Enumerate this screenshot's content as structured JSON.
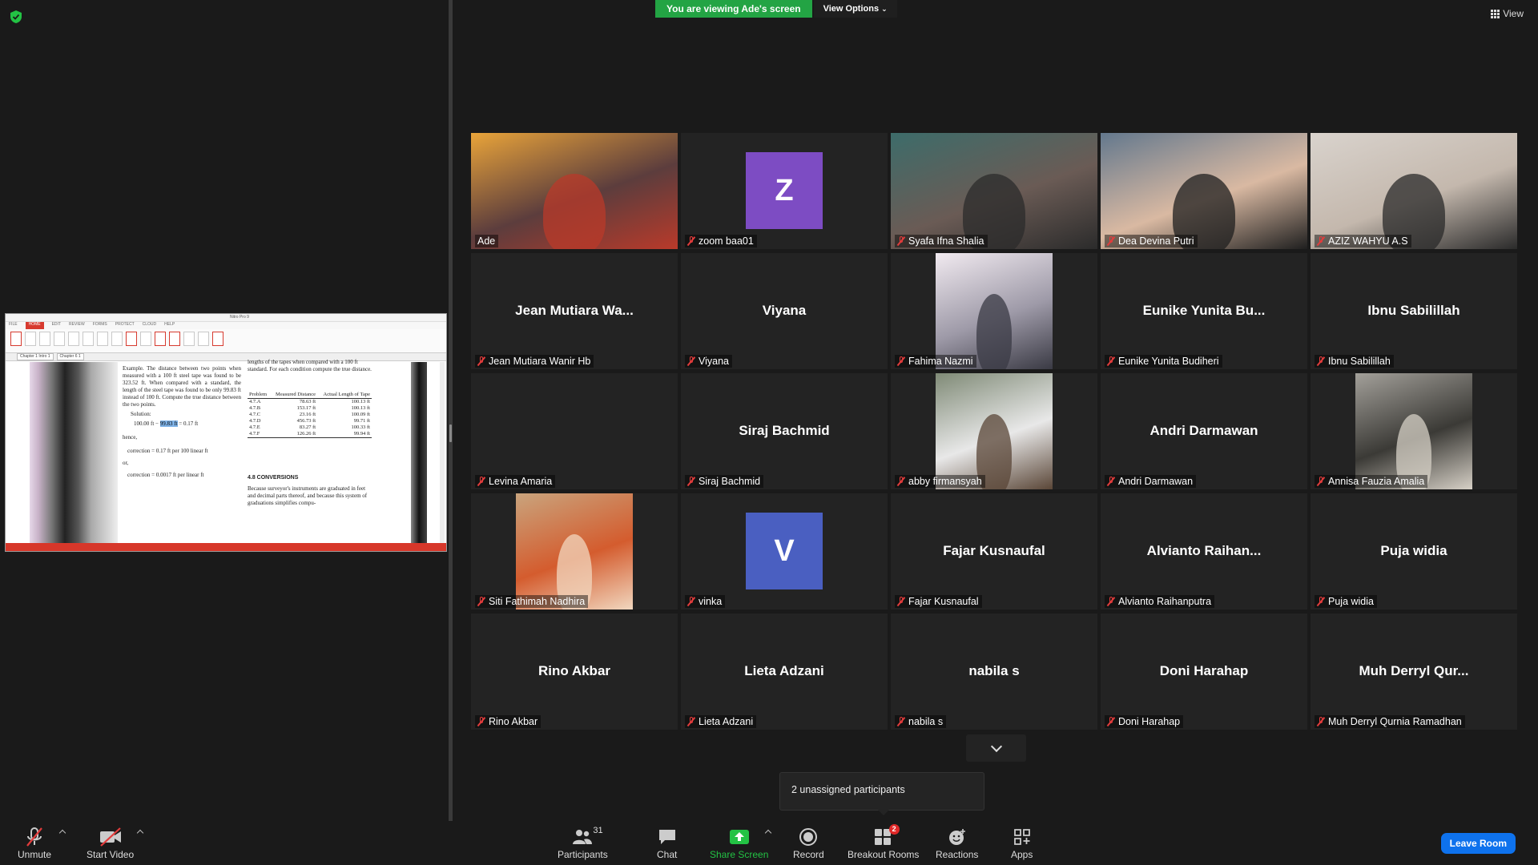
{
  "banner": {
    "viewing": "You are viewing Ade's screen",
    "view_options": "View Options"
  },
  "view_button": "View",
  "shared_window": {
    "title": "Nitro Pro 9",
    "ribbon_tabs": [
      "FILE",
      "HOME",
      "EDIT",
      "REVIEW",
      "FORMS",
      "PROTECT",
      "CLOUD",
      "HELP"
    ],
    "doc_tabs": [
      "Chapter 1 Intro 1",
      "Chapter 6 1"
    ],
    "left_col": {
      "example": "Example. The distance between two points when measured with a 100 ft steel tape was found to be 323.52 ft. When compared with a standard, the length of the steel tape was found to be only 99.83 ft instead of 100 ft. Compute the true distance between the two points.",
      "solution": "Solution:",
      "eq_pre": "100.00 ft −",
      "eq_hl": "99.83 ft",
      "eq_post": "= 0.17 ft",
      "hence": "hence,",
      "corr1": "correction = 0.17 ft per 100 linear ft",
      "or": "or,",
      "corr2": "correction = 0.0017 ft per linear ft"
    },
    "right_col": {
      "intro": "lengths of the tapes when compared with a 100 ft standard. For each condition compute the true distance.",
      "headers": [
        "Problem",
        "Measured Distance",
        "Actual Length of Tape"
      ],
      "rows": [
        [
          "4.7.A",
          "78.63 ft",
          "100.13 ft"
        ],
        [
          "4.7.B",
          "153.17 ft",
          "100.13 ft"
        ],
        [
          "4.7.C",
          "23.16 ft",
          "100.09 ft"
        ],
        [
          "4.7.D",
          "456.73 ft",
          "99.71 ft"
        ],
        [
          "4.7.E",
          "83.27 ft",
          "100.33 ft"
        ],
        [
          "4.7.F",
          "126.26 ft",
          "99.94 ft"
        ]
      ],
      "section": "4.8   CONVERSIONS",
      "section_text": "Because surveyor's instruments are graduated in feet and decimal parts thereof, and because this system of graduations simplifies compu-"
    }
  },
  "tiles": [
    {
      "label": "Ade",
      "center": "",
      "kind": "photo",
      "muted": false,
      "active": true,
      "colors": [
        "#e9a43a",
        "#5c3d3d",
        "#b93a2a"
      ]
    },
    {
      "label": "zoom baa01",
      "center": "",
      "kind": "avatar",
      "letter": "Z",
      "avatar_color": "#7d4cc3",
      "muted": true
    },
    {
      "label": "Syafa Ifna Shalia",
      "center": "",
      "kind": "photo",
      "muted": true,
      "colors": [
        "#3d6c6a",
        "#6a5b55",
        "#2b2b2b"
      ]
    },
    {
      "label": "Dea Devina Putri",
      "center": "",
      "kind": "photo",
      "muted": true,
      "colors": [
        "#63788d",
        "#d9b9a2",
        "#1f1f1f"
      ]
    },
    {
      "label": "AZIZ WAHYU A.S",
      "center": "",
      "kind": "photo",
      "muted": true,
      "colors": [
        "#d9d3cd",
        "#c4b8ad",
        "#2a2a2a"
      ]
    },
    {
      "label": "Jean Mutiara Wanir Hb",
      "center": "Jean Mutiara Wa...",
      "kind": "name",
      "muted": true
    },
    {
      "label": "Viyana",
      "center": "Viyana",
      "kind": "name",
      "muted": true
    },
    {
      "label": "Fahima Nazmi",
      "center": "",
      "kind": "photo-mid",
      "muted": true,
      "colors": [
        "#f1eaf0",
        "#9e9aa8",
        "#3a3a44"
      ]
    },
    {
      "label": "Eunike Yunita Budiheri",
      "center": "Eunike Yunita Bu...",
      "kind": "name",
      "muted": true
    },
    {
      "label": "Ibnu Sabilillah",
      "center": "Ibnu Sabilillah",
      "kind": "name",
      "muted": true
    },
    {
      "label": "Levina Amaria",
      "center": "",
      "kind": "blank",
      "muted": true
    },
    {
      "label": "Siraj Bachmid",
      "center": "Siraj Bachmid",
      "kind": "name",
      "muted": true
    },
    {
      "label": "abby firmansyah",
      "center": "",
      "kind": "photo-mid",
      "muted": true,
      "colors": [
        "#7f8a76",
        "#e8e8e8",
        "#5a4637"
      ]
    },
    {
      "label": "Andri Darmawan",
      "center": "Andri Darmawan",
      "kind": "name",
      "muted": true
    },
    {
      "label": "Annisa Fauzia Amalia",
      "center": "",
      "kind": "photo-mid",
      "muted": true,
      "colors": [
        "#a3a09a",
        "#3b3a36",
        "#d6d0c6"
      ]
    },
    {
      "label": "Siti Fathimah Nadhira",
      "center": "",
      "kind": "photo-mid",
      "muted": true,
      "colors": [
        "#c9a47d",
        "#d45c2e",
        "#f1d7bf"
      ]
    },
    {
      "label": "vinka",
      "center": "",
      "kind": "avatar",
      "letter": "V",
      "avatar_color": "#4a5fc1",
      "muted": true
    },
    {
      "label": "Fajar Kusnaufal",
      "center": "Fajar Kusnaufal",
      "kind": "name",
      "muted": true
    },
    {
      "label": "Alvianto Raihanputra",
      "center": "Alvianto  Raihan...",
      "kind": "name",
      "muted": true
    },
    {
      "label": "Puja widia",
      "center": "Puja widia",
      "kind": "name",
      "muted": true
    },
    {
      "label": "Rino Akbar",
      "center": "Rino Akbar",
      "kind": "name",
      "muted": true
    },
    {
      "label": "Lieta Adzani",
      "center": "Lieta Adzani",
      "kind": "name",
      "muted": true
    },
    {
      "label": "nabila s",
      "center": "nabila s",
      "kind": "name",
      "muted": true
    },
    {
      "label": "Doni Harahap",
      "center": "Doni Harahap",
      "kind": "name",
      "muted": true
    },
    {
      "label": "Muh Derryl Qurnia Ramadhan",
      "center": "Muh Derryl Qur...",
      "kind": "name",
      "muted": true
    }
  ],
  "popover": {
    "text": "2 unassigned participants"
  },
  "toolbar": {
    "unmute": "Unmute",
    "start_video": "Start Video",
    "participants": "Participants",
    "participants_count": "31",
    "chat": "Chat",
    "share_screen": "Share Screen",
    "record": "Record",
    "breakout_rooms": "Breakout Rooms",
    "breakout_badge": "2",
    "reactions": "Reactions",
    "apps": "Apps",
    "leave_room": "Leave Room"
  },
  "colors": {
    "share_green": "#23c244",
    "leave_blue": "#0e72ed",
    "active_speaker": "#f0df63",
    "muted_red": "#e23c3c"
  }
}
